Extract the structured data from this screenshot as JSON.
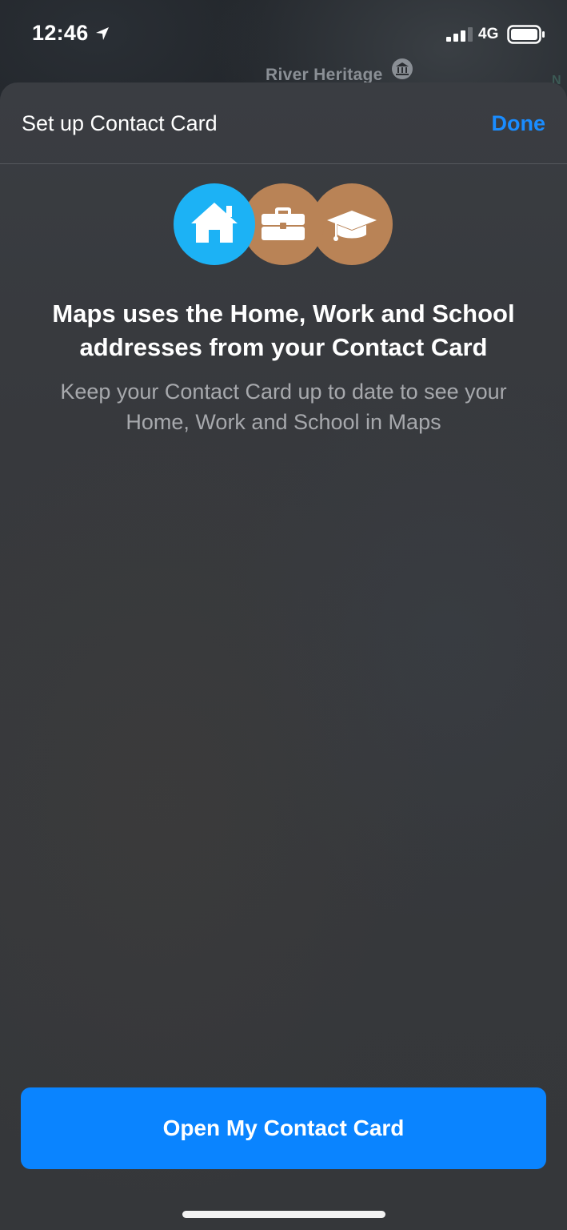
{
  "status_bar": {
    "time": "12:46",
    "network": "4G",
    "icons": [
      "location-arrow-icon",
      "signal-icon",
      "battery-icon"
    ]
  },
  "map": {
    "label": "River Heritage",
    "edge_label": "N",
    "poi_icon": "museum-icon"
  },
  "sheet": {
    "title": "Set up Contact Card",
    "done_label": "Done",
    "icons": [
      "home-icon",
      "briefcase-icon",
      "graduation-cap-icon"
    ],
    "headline": "Maps uses the Home, Work and School addresses from your Contact Card",
    "subtext": "Keep your Contact Card up to date to see your Home, Work and School in Maps",
    "primary_button_label": "Open My Contact Card"
  },
  "colors": {
    "accent": "#0a84ff",
    "done_text": "#1a8cff",
    "home_circle": "#1cb2f5",
    "work_school_circle": "#b98356",
    "sheet_background": "#37393d"
  }
}
